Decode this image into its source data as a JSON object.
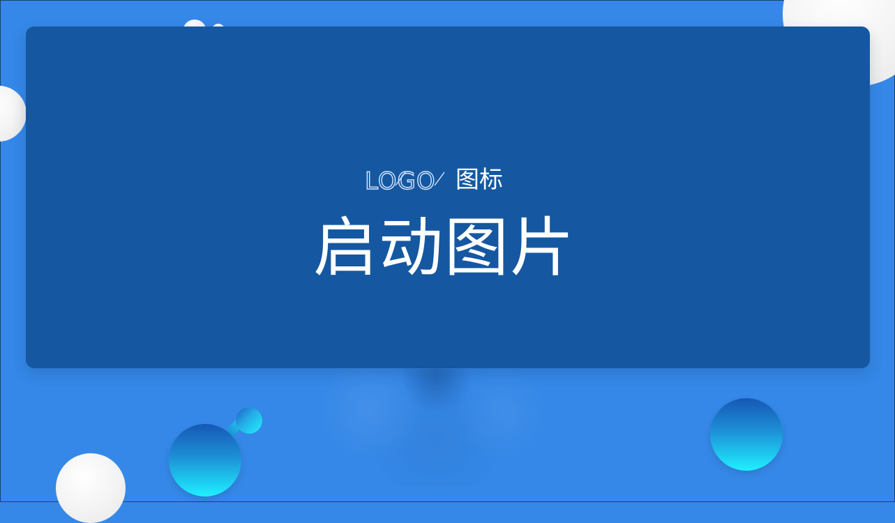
{
  "slide": {
    "logo_mark_text": "LOGO",
    "logo_label": "图标",
    "headline": "启动图片"
  },
  "colors": {
    "background": "#3588e8",
    "card": "#1558a1",
    "white_text": "#ffffff",
    "teal_accent_start": "#1558b5",
    "teal_accent_end": "#1ff0ff",
    "white_circle": "#f3f3f3"
  },
  "decor": {
    "icons": [
      "white-circle-decoration",
      "teal-circle-decoration",
      "teal-connector-decoration"
    ]
  }
}
